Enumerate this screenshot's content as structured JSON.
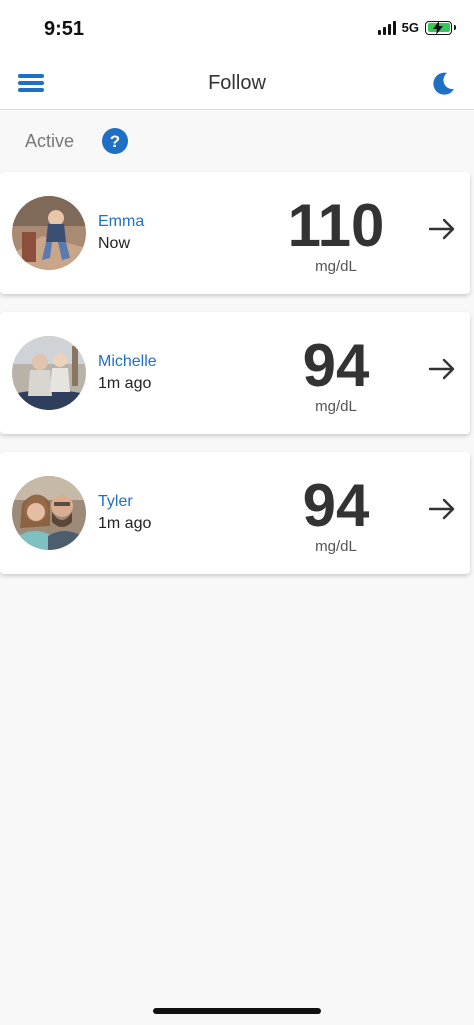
{
  "status_bar": {
    "time": "9:51",
    "network": "5G",
    "battery_level": 1.0,
    "charging": true
  },
  "nav": {
    "title": "Follow",
    "menu_icon": "hamburger-icon",
    "theme_icon": "moon-icon"
  },
  "section": {
    "label": "Active",
    "help_icon": "question-circle-icon"
  },
  "followers": [
    {
      "name": "Emma",
      "time": "Now",
      "value": "110",
      "unit": "mg/dL"
    },
    {
      "name": "Michelle",
      "time": "1m ago",
      "value": "94",
      "unit": "mg/dL"
    },
    {
      "name": "Tyler",
      "time": "1m ago",
      "value": "94",
      "unit": "mg/dL"
    }
  ],
  "colors": {
    "accent": "#1f6fc5",
    "background": "#f8f8f8",
    "card": "#ffffff",
    "battery": "#34c759"
  }
}
